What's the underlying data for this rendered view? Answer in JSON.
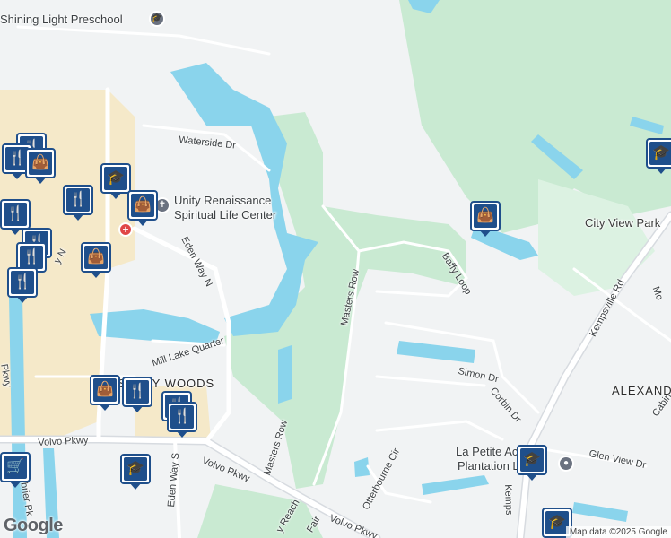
{
  "map": {
    "colors": {
      "land": "#f1f3f4",
      "water": "#8ad4ec",
      "park": "#c9ead2",
      "parkLight": "#dcf2e2",
      "tan": "#f5e9c9",
      "road": "#ffffff",
      "roadEdge": "#d7dbe0",
      "marker": "#1f4f8b"
    },
    "poi_labels": {
      "shining_light": "Shining Light Preschool",
      "unity_line1": "Unity Renaissance",
      "unity_line2": "Spiritual Life Center",
      "city_view_park": "City View Park",
      "la_petite_line1": "La Petite Acad",
      "la_petite_line2": "Plantation Lakes",
      "ashley_woods": "ASHLEY WOODS",
      "alexand": "ALEXAND"
    },
    "street_labels": {
      "waterside": "Waterside Dr",
      "eden_way_n": "Eden Way N",
      "mill_lake": "Mill Lake Quarter",
      "masters_row_1": "Masters Row",
      "masters_row_2": "Masters Row",
      "baffy_loop": "Baffy Loop",
      "simon": "Simon Dr",
      "corbin": "Corbin Dr",
      "glen_view": "Glen View Dr",
      "kempsville": "Kempsville Rd",
      "kemps": "Kemps",
      "volvo_1": "Volvo Pkwy",
      "volvo_2": "Volvo Pkwy",
      "volvo_3": "Volvo Pkwy",
      "eden_way_s": "Eden Way S",
      "otterbourne": "Otterbourne Cir",
      "cabin": "Cabin",
      "mo": "Mo",
      "pkwy": "Pkwy",
      "nbrier": "enbrier Pk",
      "e_n": "y N",
      "reach": "y Reach",
      "fair": "Fair"
    },
    "markers": [
      {
        "icon": "fork-knife-icon",
        "glyph": "🍴"
      },
      {
        "icon": "shopping-bag-icon",
        "glyph": "👜"
      },
      {
        "icon": "graduation-cap-icon",
        "glyph": "🎓"
      },
      {
        "icon": "shopping-cart-icon",
        "glyph": "🛒"
      }
    ],
    "google_logo": "Google",
    "attribution": "Map data ©2025 Google"
  }
}
